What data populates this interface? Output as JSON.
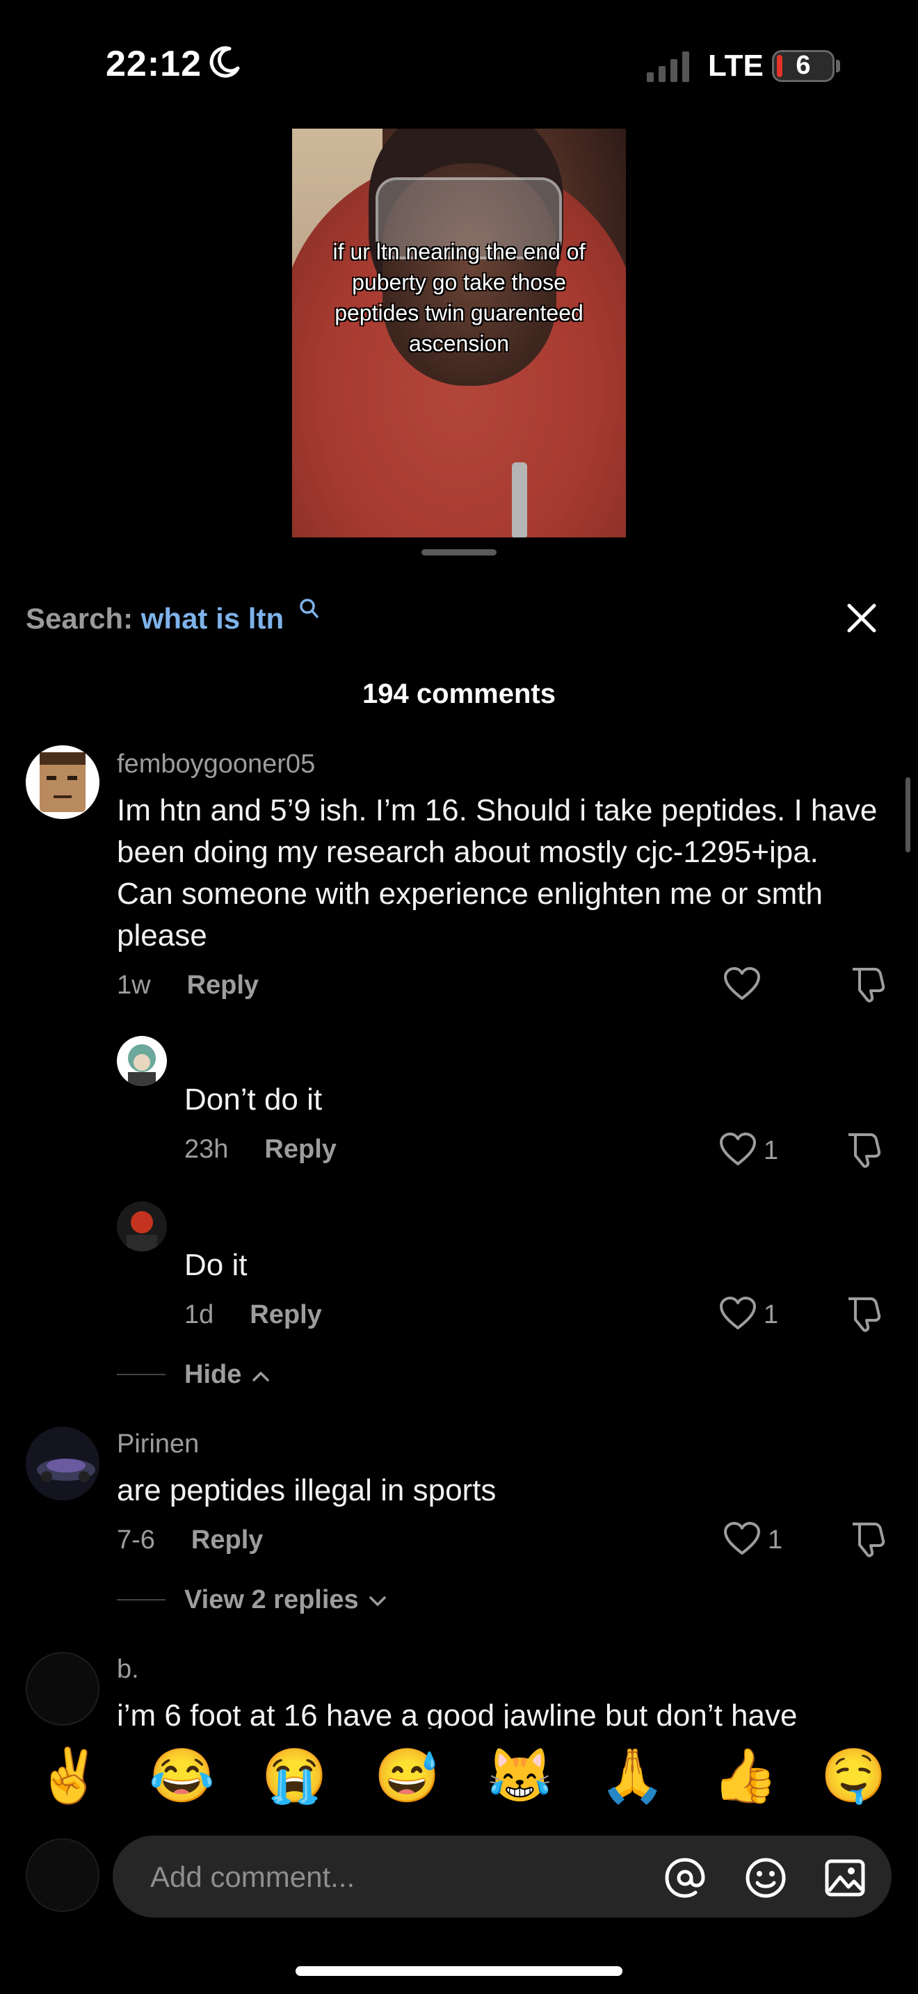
{
  "status": {
    "time": "22:12",
    "network": "LTE",
    "battery": "6"
  },
  "video": {
    "caption": "if ur ltn nearing the end of puberty go take those peptides twin guarenteed ascension"
  },
  "search": {
    "label": "Search:",
    "term": "what is ltn"
  },
  "comments_header": {
    "count_label": "194 comments"
  },
  "comments": [
    {
      "username": "femboygooner05",
      "text": "Im htn and 5’9 ish. I’m 16. Should i take peptides. I have been doing my research about mostly cjc-1295+ipa. Can someone with experience enlighten me or smth please",
      "age": "1w",
      "reply_label": "Reply",
      "likes": "",
      "replies": [
        {
          "text": "Don’t do it",
          "age": "23h",
          "reply_label": "Reply",
          "likes": "1"
        },
        {
          "text": "Do it",
          "age": "1d",
          "reply_label": "Reply",
          "likes": "1"
        }
      ],
      "thread_toggle": "Hide"
    },
    {
      "username": "Pirinen",
      "text": "are peptides illegal in sports",
      "age": "7-6",
      "reply_label": "Reply",
      "likes": "1",
      "thread_toggle": "View 2 replies"
    },
    {
      "username": "b.",
      "text": "i’m 6 foot at 16 have a good jawline but don’t have"
    }
  ],
  "emoji_bar": [
    "✌️",
    "😂",
    "😭",
    "😅",
    "😹",
    "🙏",
    "👍",
    "🤤"
  ],
  "composer": {
    "placeholder": "Add comment..."
  },
  "icons": [
    "moon-icon",
    "signal-icon",
    "battery-icon",
    "search-icon",
    "close-icon",
    "heart-icon",
    "dislike-icon",
    "chevron-up-icon",
    "chevron-down-icon",
    "at-icon",
    "emoji-icon",
    "image-icon"
  ]
}
